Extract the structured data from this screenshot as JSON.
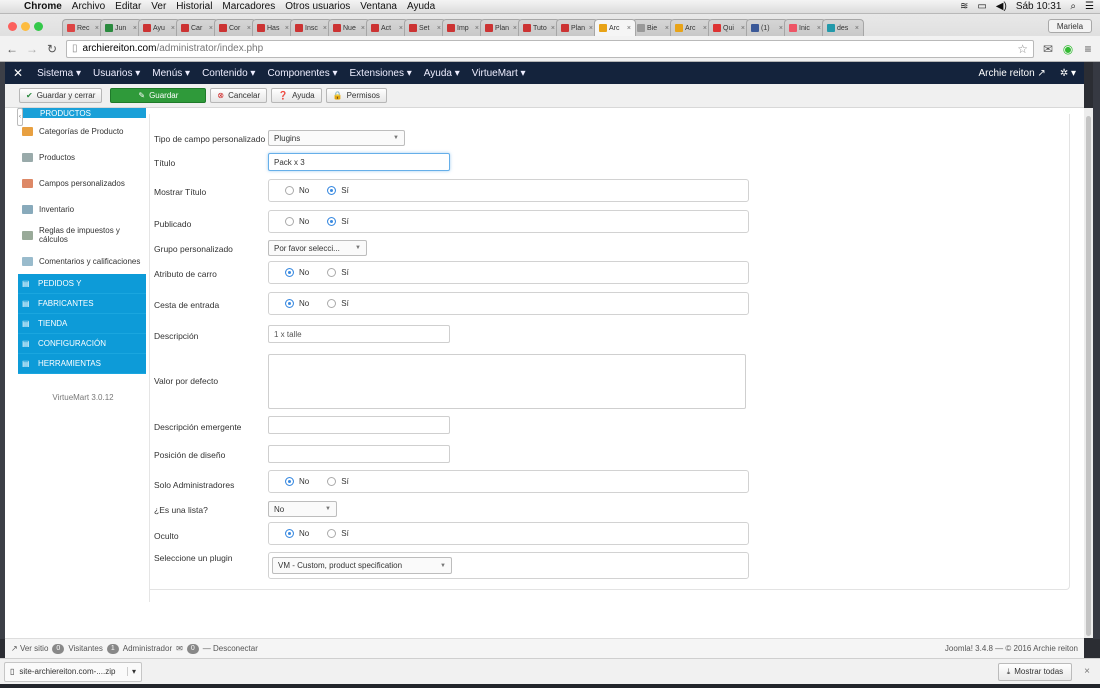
{
  "mac": {
    "app": "Chrome",
    "menu": [
      "Archivo",
      "Editar",
      "Ver",
      "Historial",
      "Marcadores",
      "Otros usuarios",
      "Ventana",
      "Ayuda"
    ],
    "clock": "Sáb 10:31"
  },
  "browser": {
    "tabs": [
      {
        "label": "Rec",
        "color": "#d44"
      },
      {
        "label": "Jun",
        "color": "#2a8a3e"
      },
      {
        "label": "Ayu",
        "color": "#c33"
      },
      {
        "label": "Car",
        "color": "#c33"
      },
      {
        "label": "Cor",
        "color": "#c33"
      },
      {
        "label": "Has",
        "color": "#c33"
      },
      {
        "label": "Insc",
        "color": "#c33"
      },
      {
        "label": "Nue",
        "color": "#c33"
      },
      {
        "label": "Act",
        "color": "#c33"
      },
      {
        "label": "Set",
        "color": "#c33"
      },
      {
        "label": "Imp",
        "color": "#c33"
      },
      {
        "label": "Plan",
        "color": "#c33"
      },
      {
        "label": "Tuto",
        "color": "#c33"
      },
      {
        "label": "Plan",
        "color": "#c33"
      },
      {
        "label": "Arc",
        "color": "#e8a317",
        "active": true
      },
      {
        "label": "Bie",
        "color": "#999"
      },
      {
        "label": "Arc",
        "color": "#e8a317"
      },
      {
        "label": "Qui",
        "color": "#d33"
      },
      {
        "label": "(1)",
        "color": "#3b5998"
      },
      {
        "label": "Inic",
        "color": "#e56"
      },
      {
        "label": "des",
        "color": "#29a"
      }
    ],
    "profile": "Mariela",
    "url_host": "archiereiton.com",
    "url_path": "/administrator/index.php"
  },
  "joomla_nav": {
    "items": [
      "Sistema ▾",
      "Usuarios ▾",
      "Menús ▾",
      "Contenido ▾",
      "Componentes ▾",
      "Extensiones ▾",
      "Ayuda ▾",
      "VirtueMart ▾"
    ],
    "user": "Archie reiton"
  },
  "toolbar": {
    "save_close": "Guardar y cerrar",
    "save": "Guardar",
    "cancel": "Cancelar",
    "help": "Ayuda",
    "perms": "Permisos"
  },
  "sidebar": {
    "header": "PRODUCTOS",
    "items": [
      {
        "label": "Categorías de Producto",
        "color": "#e8a040"
      },
      {
        "label": "Productos",
        "color": "#9aa"
      },
      {
        "label": "Campos personalizados",
        "color": "#d86"
      },
      {
        "label": "Inventario",
        "color": "#8ab"
      },
      {
        "label": "Reglas de impuestos y cálculos",
        "color": "#9a9"
      },
      {
        "label": "Comentarios y calificaciones",
        "color": "#9bc"
      }
    ],
    "sections": [
      "PEDIDOS Y",
      "FABRICANTES",
      "TIENDA",
      "CONFIGURACIÓN",
      "HERRAMIENTAS"
    ],
    "version": "VirtueMart 3.0.12"
  },
  "form": {
    "tipo_label": "Tipo de campo personalizado",
    "tipo_value": "Plugins",
    "titulo_label": "Título",
    "titulo_value": "Pack x 3",
    "mostrar_label": "Mostrar Título",
    "publicado_label": "Publicado",
    "grupo_label": "Grupo personalizado",
    "grupo_value": "Por favor selecci...",
    "atributo_label": "Atributo de carro",
    "cesta_label": "Cesta de entrada",
    "descripcion_label": "Descripción",
    "descripcion_placeholder": "1 x talle",
    "valor_label": "Valor por defecto",
    "emergente_label": "Descripción emergente",
    "posicion_label": "Posición de diseño",
    "solo_label": "Solo Administradores",
    "lista_label": "¿Es una lista?",
    "lista_value": "No",
    "oculto_label": "Oculto",
    "plugin_label": "Seleccione un plugin",
    "plugin_value": "VM - Custom, product specification",
    "no": "No",
    "si": "Sí"
  },
  "status": {
    "ver_sitio": "Ver sitio",
    "visitors_count": "0",
    "visitors": "Visitantes",
    "admin_count": "1",
    "admin": "Administrador",
    "msg_count": "0",
    "logout": "Desconectar",
    "version": "Joomla! 3.4.8 — © 2016 Archie reiton"
  },
  "downloads": {
    "file": "site-archiereiton.com-....zip",
    "show_all": "Mostrar todas"
  }
}
